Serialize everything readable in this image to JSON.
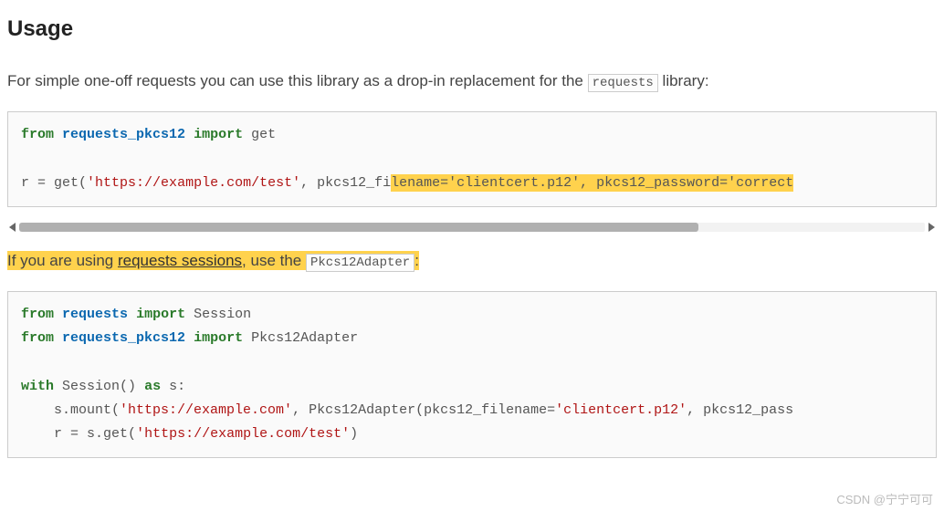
{
  "heading": "Usage",
  "intro": {
    "p1_a": "For simple one-off requests you can use this library as a drop-in replacement for the ",
    "inline_code": "requests",
    "p1_b": " library:"
  },
  "code1": {
    "line1": {
      "kw_from": "from",
      "sp1": " ",
      "mod": "requests_pkcs12",
      "sp2": " ",
      "kw_import": "import",
      "sp3": " ",
      "sym": "get"
    },
    "line2": {
      "lhs": "r ",
      "op_eq": "=",
      "sp": " get(",
      "str1": "'https://example.com/test'",
      "mid": ", pkcs12_fi",
      "hl": "lename='clientcert.p12', pkcs12_password='correct"
    }
  },
  "para2": {
    "a": "If you are using ",
    "link": "requests sessions",
    "b": ", use the ",
    "code": "Pkcs12Adapter",
    "c": ":"
  },
  "code2": {
    "l1": {
      "kw_from": "from",
      "sp1": " ",
      "mod": "requests",
      "sp2": " ",
      "kw_import": "import",
      "sp3": " ",
      "sym": "Session"
    },
    "l2": {
      "kw_from": "from",
      "sp1": " ",
      "mod": "requests_pkcs12",
      "sp2": " ",
      "kw_import": "import",
      "sp3": " ",
      "sym": "Pkcs12Adapter"
    },
    "l3": {
      "kw_with": "with",
      "sp1": " ",
      "call": "Session()",
      "sp2": " ",
      "kw_as": "as",
      "sp3": " ",
      "var": "s:"
    },
    "l4": {
      "indent": "    ",
      "pre": "s.mount(",
      "str1": "'https://example.com'",
      "mid": ", Pkcs12Adapter(pkcs12_filename=",
      "str2": "'clientcert.p12'",
      "tail": ", pkcs12_pass"
    },
    "l5": {
      "indent": "    ",
      "pre": "r ",
      "eq": "=",
      "sp": " s.get(",
      "str1": "'https://example.com/test'",
      "end": ")"
    }
  },
  "watermark": "CSDN @宁宁可可"
}
